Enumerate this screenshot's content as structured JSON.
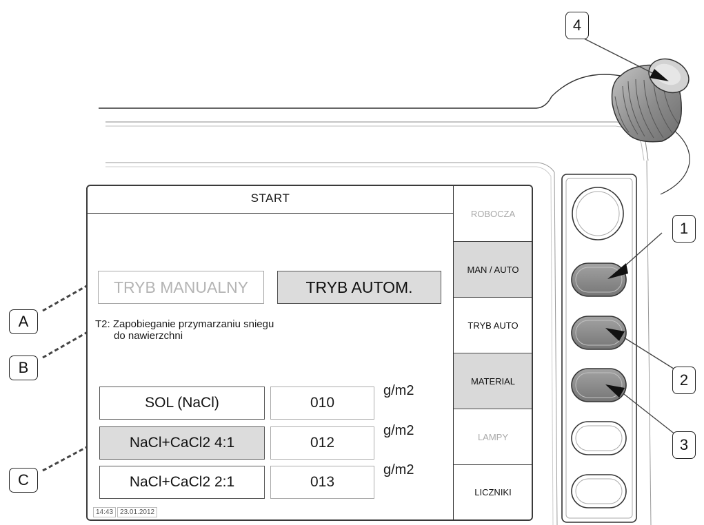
{
  "screen": {
    "title": "START",
    "menu": [
      {
        "label": "ROBOCZA",
        "state": "inactive"
      },
      {
        "label": "MAN / AUTO",
        "state": "active"
      },
      {
        "label": "TRYB AUTO",
        "state": "normal"
      },
      {
        "label": "MATERIAL",
        "state": "active"
      },
      {
        "label": "LAMPY",
        "state": "inactive"
      },
      {
        "label": "LICZNIKI",
        "state": "normal"
      }
    ],
    "modes": {
      "manual": {
        "label": "TRYB MANUALNY",
        "state": "inactive"
      },
      "auto": {
        "label": "TRYB AUTOM.",
        "state": "selected"
      }
    },
    "program": {
      "line1": "T2: Zapobieganie przymarzaniu sniegu",
      "line2": "do nawierzchni"
    },
    "materials": [
      {
        "name": "SOL (NaCl)",
        "value": "010",
        "unit": "g/m2",
        "selected": false
      },
      {
        "name": "NaCl+CaCl2 4:1",
        "value": "012",
        "unit": "g/m2",
        "selected": true
      },
      {
        "name": "NaCl+CaCl2 2:1",
        "value": "013",
        "unit": "g/m2",
        "selected": false
      }
    ],
    "status": {
      "time": "14:43",
      "date": "23.01.2012"
    }
  },
  "callouts": {
    "a": "A",
    "b": "B",
    "c": "C",
    "n1": "1",
    "n2": "2",
    "n3": "3",
    "n4": "4"
  },
  "colors": {
    "active_menu": "#d9d9d9",
    "selected_button": "#dcdcdc",
    "inactive_text": "#a8a8a8",
    "hardware_button": "#8a8a8a",
    "knob": "#9a9a9a"
  }
}
